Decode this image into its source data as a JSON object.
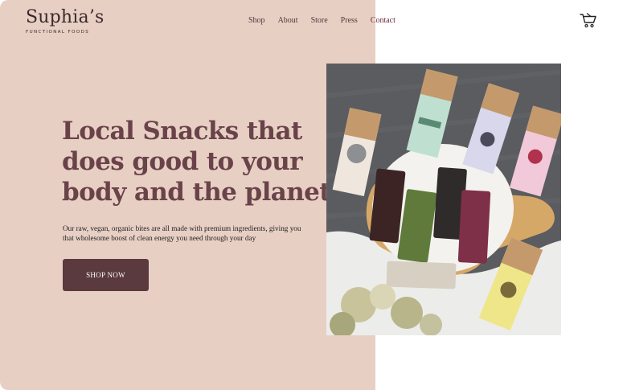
{
  "brand": {
    "name": "Suphia’s",
    "tagline": "FUNCTIONAL FOODS"
  },
  "nav": {
    "items": [
      "Shop",
      "About",
      "Store",
      "Press",
      "Contact"
    ]
  },
  "hero": {
    "title_lines": [
      "Local Snacks that",
      "does good to your",
      "body and the planet"
    ],
    "description": "Our raw, vegan, organic bites are all made with premium ingredients, giving you that wholesome boost of clean energy you need through your day",
    "cta_label": "SHOP NOW"
  },
  "icons": {
    "cart": "shopping-cart-icon"
  },
  "colors": {
    "left_background": "#e8cfc4",
    "title": "#6a434a",
    "button": "#5a3a3f",
    "accent_link": "#6b2b3a"
  }
}
